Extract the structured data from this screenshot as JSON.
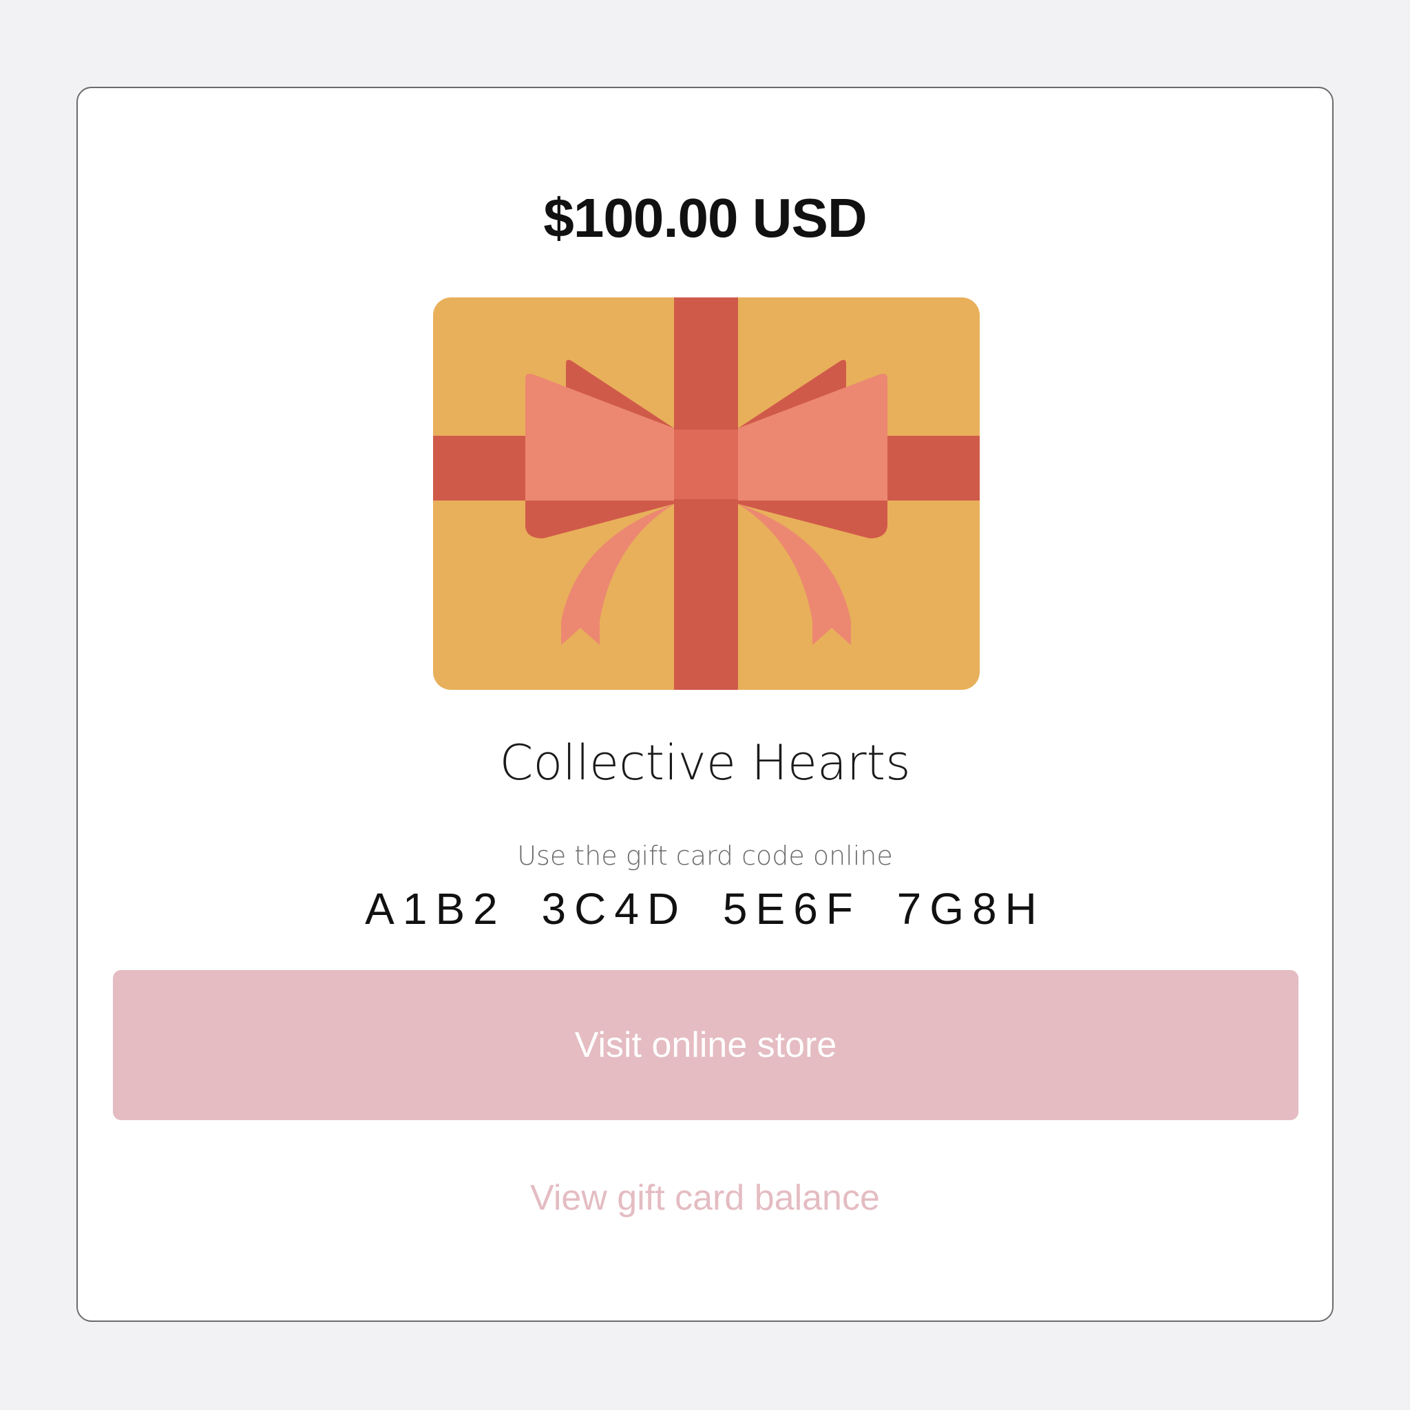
{
  "gift_card": {
    "amount": "$100.00 USD",
    "image_icon": "gift-box-with-bow-icon",
    "store_name": "Collective Hearts",
    "code_caption": "Use the gift card code online",
    "code": "A1B2 3C4D 5E6F 7G8H"
  },
  "actions": {
    "visit_store_label": "Visit online store",
    "view_balance_label": "View gift card balance"
  },
  "colors": {
    "page_background": "#f2f1f4",
    "card_background": "#ffffff",
    "card_border": "#6b6b6b",
    "gift_box": "#e8b05a",
    "ribbon": "#d05a4a",
    "bow": "#ec8872",
    "bow_knot": "#e06a58",
    "button_background": "#e4bcc2",
    "button_text": "#ffffff",
    "link_text": "#e4bcc2"
  }
}
